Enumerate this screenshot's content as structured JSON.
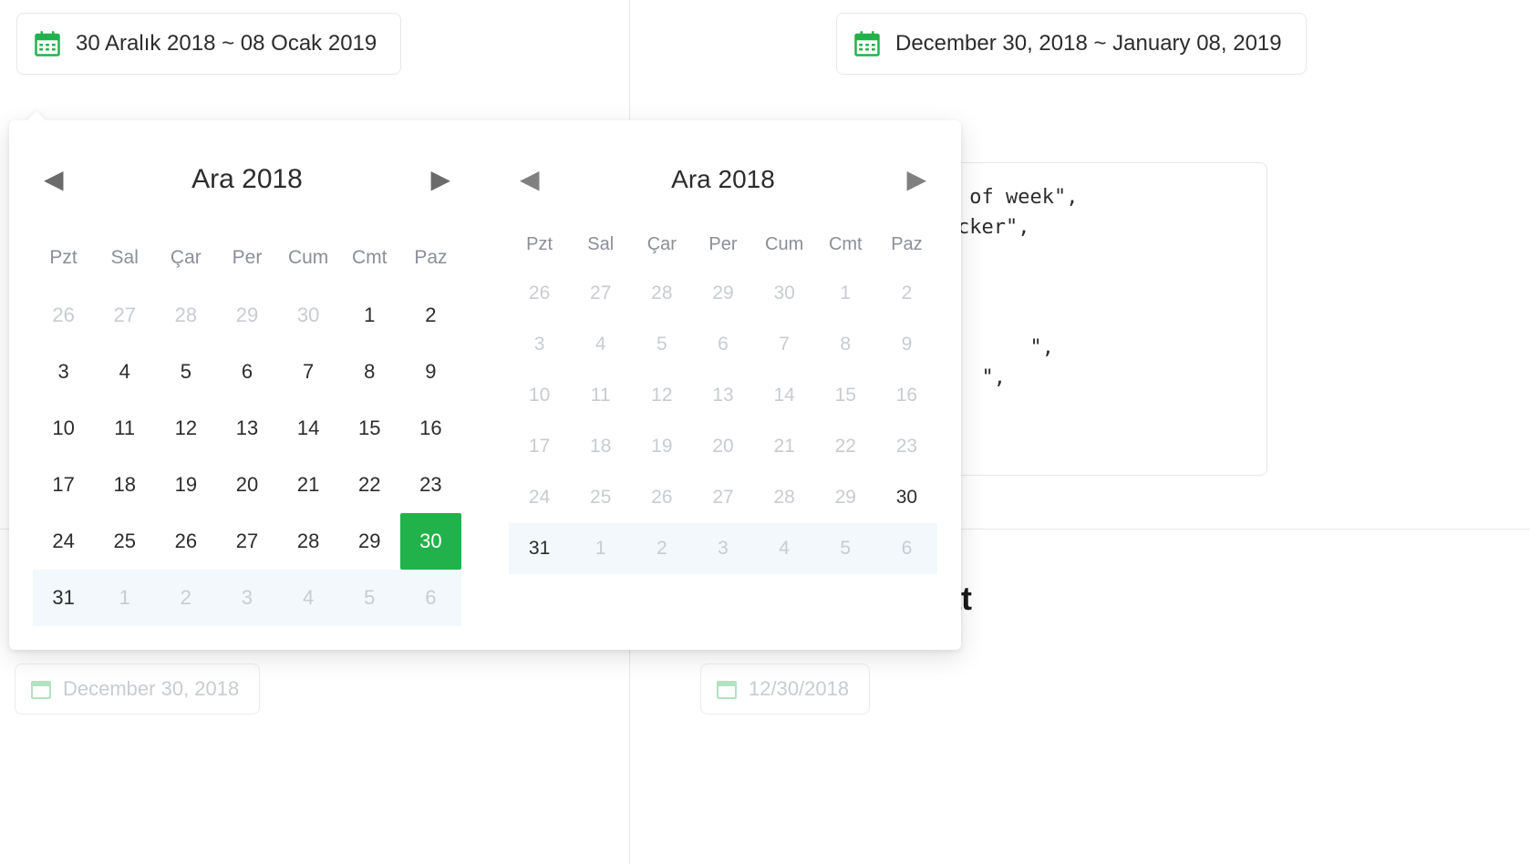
{
  "inputs": {
    "left_value": "30 Aralık 2018 ~ 08 Ocak 2019",
    "right_value": "December 30, 2018 ~ January 08, 2019"
  },
  "calendars": {
    "left": {
      "title": "Ara 2018",
      "dow": [
        "Pzt",
        "Sal",
        "Çar",
        "Per",
        "Cum",
        "Cmt",
        "Paz"
      ],
      "cells": [
        {
          "d": "26",
          "muted": true
        },
        {
          "d": "27",
          "muted": true
        },
        {
          "d": "28",
          "muted": true
        },
        {
          "d": "29",
          "muted": true
        },
        {
          "d": "30",
          "muted": true
        },
        {
          "d": "1"
        },
        {
          "d": "2"
        },
        {
          "d": "3"
        },
        {
          "d": "4"
        },
        {
          "d": "5"
        },
        {
          "d": "6"
        },
        {
          "d": "7"
        },
        {
          "d": "8"
        },
        {
          "d": "9"
        },
        {
          "d": "10"
        },
        {
          "d": "11"
        },
        {
          "d": "12"
        },
        {
          "d": "13"
        },
        {
          "d": "14"
        },
        {
          "d": "15"
        },
        {
          "d": "16"
        },
        {
          "d": "17"
        },
        {
          "d": "18"
        },
        {
          "d": "19"
        },
        {
          "d": "20"
        },
        {
          "d": "21"
        },
        {
          "d": "22"
        },
        {
          "d": "23"
        },
        {
          "d": "24"
        },
        {
          "d": "25"
        },
        {
          "d": "26"
        },
        {
          "d": "27"
        },
        {
          "d": "28"
        },
        {
          "d": "29"
        },
        {
          "d": "30",
          "selected": true
        },
        {
          "d": "31",
          "range": true,
          "dark": true
        },
        {
          "d": "1",
          "range": true,
          "muted": true
        },
        {
          "d": "2",
          "range": true,
          "muted": true
        },
        {
          "d": "3",
          "range": true,
          "muted": true
        },
        {
          "d": "4",
          "range": true,
          "muted": true
        },
        {
          "d": "5",
          "range": true,
          "muted": true
        },
        {
          "d": "6",
          "range": true,
          "muted": true
        }
      ]
    },
    "right": {
      "title": "Ara 2018",
      "dow": [
        "Pzt",
        "Sal",
        "Çar",
        "Per",
        "Cum",
        "Cmt",
        "Paz"
      ],
      "cells": [
        {
          "d": "26",
          "muted": true
        },
        {
          "d": "27",
          "muted": true
        },
        {
          "d": "28",
          "muted": true
        },
        {
          "d": "29",
          "muted": true
        },
        {
          "d": "30",
          "muted": true
        },
        {
          "d": "1",
          "muted": true
        },
        {
          "d": "2",
          "muted": true
        },
        {
          "d": "3",
          "muted": true
        },
        {
          "d": "4",
          "muted": true
        },
        {
          "d": "5",
          "muted": true
        },
        {
          "d": "6",
          "muted": true
        },
        {
          "d": "7",
          "muted": true
        },
        {
          "d": "8",
          "muted": true
        },
        {
          "d": "9",
          "muted": true
        },
        {
          "d": "10",
          "muted": true
        },
        {
          "d": "11",
          "muted": true
        },
        {
          "d": "12",
          "muted": true
        },
        {
          "d": "13",
          "muted": true
        },
        {
          "d": "14",
          "muted": true
        },
        {
          "d": "15",
          "muted": true
        },
        {
          "d": "16",
          "muted": true
        },
        {
          "d": "17",
          "muted": true
        },
        {
          "d": "18",
          "muted": true
        },
        {
          "d": "19",
          "muted": true
        },
        {
          "d": "20",
          "muted": true
        },
        {
          "d": "21",
          "muted": true
        },
        {
          "d": "22",
          "muted": true
        },
        {
          "d": "23",
          "muted": true
        },
        {
          "d": "24",
          "muted": true
        },
        {
          "d": "25",
          "muted": true
        },
        {
          "d": "26",
          "muted": true
        },
        {
          "d": "27",
          "muted": true
        },
        {
          "d": "28",
          "muted": true
        },
        {
          "d": "29",
          "muted": true
        },
        {
          "d": "30",
          "dark": true
        },
        {
          "d": "31",
          "range": true,
          "dark": true
        },
        {
          "d": "1",
          "range": true,
          "muted": true
        },
        {
          "d": "2",
          "range": true,
          "muted": true
        },
        {
          "d": "3",
          "range": true,
          "muted": true
        },
        {
          "d": "4",
          "range": true,
          "muted": true
        },
        {
          "d": "5",
          "range": true,
          "muted": true
        },
        {
          "d": "6",
          "range": true,
          "muted": true
        }
      ]
    }
  },
  "bg": {
    "line1": " of week\",",
    "line2": "cker\",",
    "line3": "\",",
    "line4": "\","
  },
  "heading_partial": "at",
  "ghost_inputs": {
    "left": "December 30, 2018",
    "right": "12/30/2018"
  }
}
